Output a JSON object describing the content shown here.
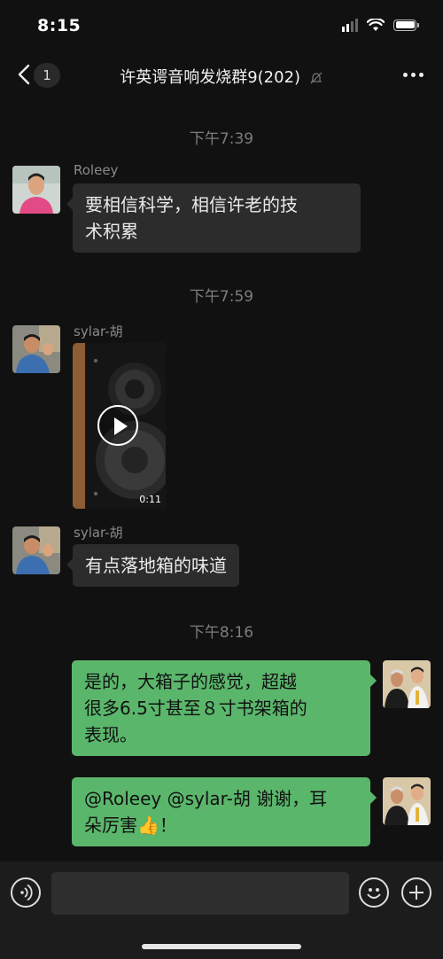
{
  "status_bar": {
    "time": "8:15"
  },
  "nav": {
    "unread_count": "1",
    "title": "许英谔音响发烧群9(202)"
  },
  "messages": [
    {
      "type": "timestamp",
      "text": "下午7:39"
    },
    {
      "type": "incoming",
      "sender": "Roleey",
      "text_lines": [
        "要相信科学，相信许老的技",
        "术积累"
      ]
    },
    {
      "type": "timestamp",
      "text": "下午7:59"
    },
    {
      "type": "incoming-video",
      "sender": "sylar-胡",
      "duration": "0:11"
    },
    {
      "type": "incoming",
      "sender": "sylar-胡",
      "text": "有点落地箱的味道"
    },
    {
      "type": "timestamp",
      "text": "下午8:16"
    },
    {
      "type": "outgoing",
      "text_lines": [
        "是的，大箱子的感觉，超越",
        "很多6.5寸甚至８寸书架箱的",
        "表现。"
      ]
    },
    {
      "type": "outgoing",
      "text_lines": [
        "@Roleey @sylar-胡 谢谢，耳",
        "朵厉害👍！"
      ]
    }
  ],
  "input": {
    "placeholder": ""
  },
  "colors": {
    "background": "#111111",
    "incoming_bubble": "#2c2c2c",
    "outgoing_bubble": "#5ab66b"
  }
}
